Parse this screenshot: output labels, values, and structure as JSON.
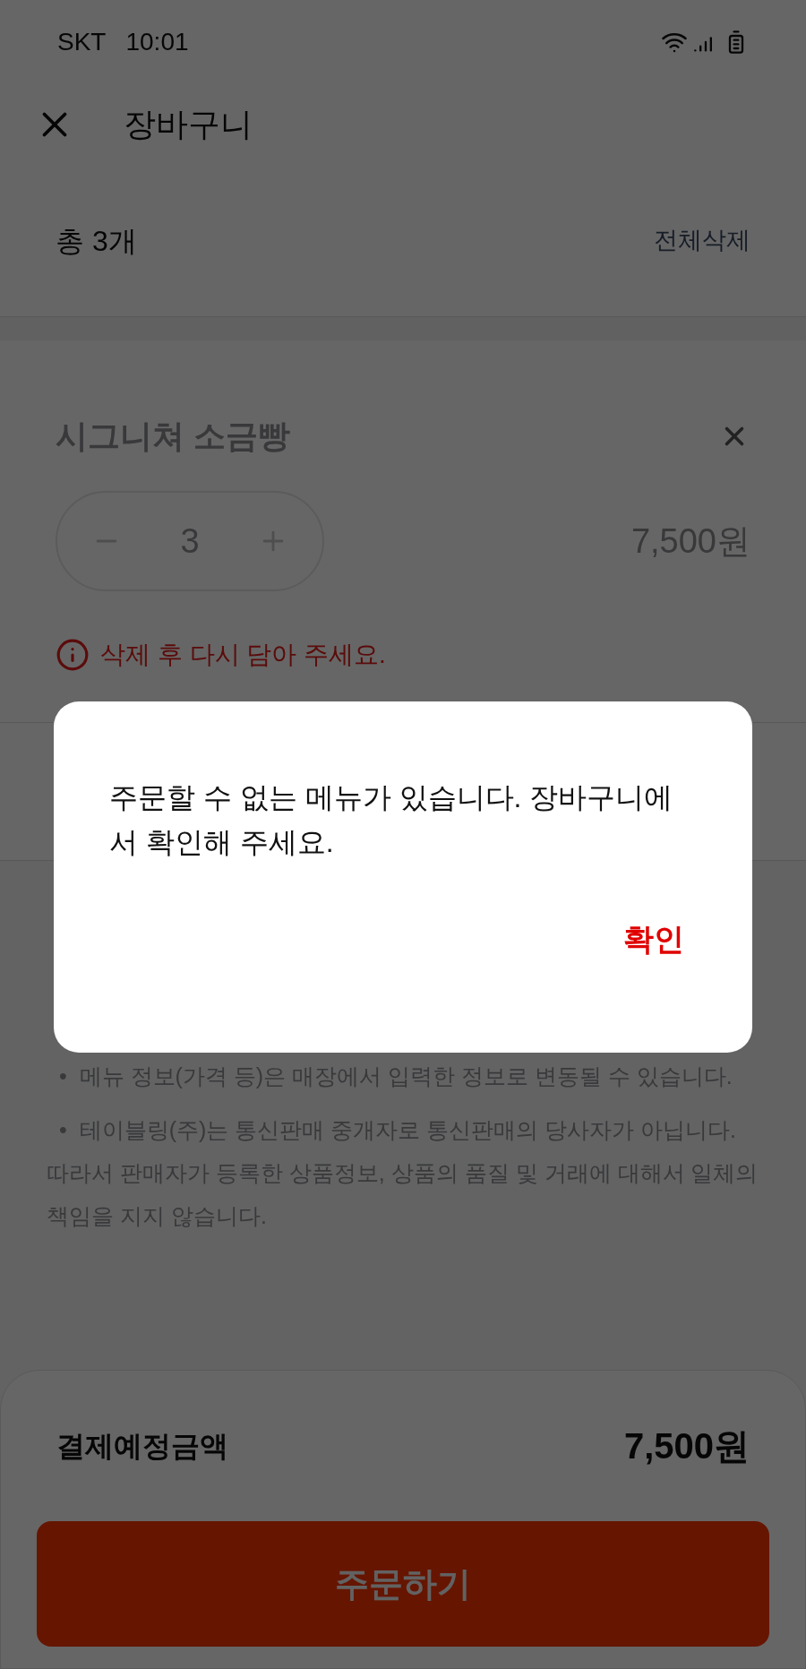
{
  "status_bar": {
    "carrier": "SKT",
    "time": "10:01"
  },
  "header": {
    "title": "장바구니"
  },
  "cart_summary": {
    "count": "총 3개",
    "delete_all": "전체삭제"
  },
  "items": [
    {
      "name": "시그니쳐 소금빵",
      "quantity": "3",
      "price": "7,500원",
      "disabled": true,
      "warning": "삭제 후 다시 담아 주세요."
    }
  ],
  "notices": [
    "•  메뉴 정보(가격 등)은 매장에서 입력한 정보로 변동될 수 있습니다.",
    "•  테이블링(주)는 통신판매 중개자로 통신판매의 당사자가 아닙니다. 따라서 판매자가 등록한 상품정보, 상품의 품질 및 거래에 대해서 일체의 책임을 지지 않습니다."
  ],
  "total": {
    "label": "결제예정금액",
    "amount": "7,500원"
  },
  "order_button": {
    "label": "주문하기"
  },
  "dialog": {
    "message": "주문할 수 없는 메뉴가 있습니다. 장바구니에서 확인해 주세요.",
    "confirm": "확인"
  }
}
